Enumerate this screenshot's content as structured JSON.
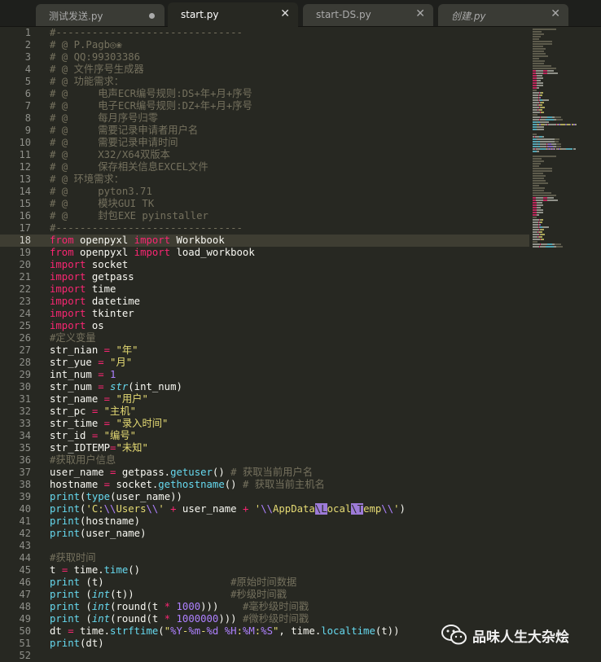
{
  "tabs": [
    {
      "label": "测试发送.py",
      "state": "modified"
    },
    {
      "label": "start.py",
      "state": "active"
    },
    {
      "label": "start-DS.py",
      "state": "normal"
    },
    {
      "label": "创建.py",
      "state": "normal"
    }
  ],
  "current_line": 18,
  "watermark": {
    "text": "品味人生大杂烩",
    "icon": "wechat-icon"
  },
  "lines": [
    [
      [
        "c",
        "#-------------------------------"
      ]
    ],
    [
      [
        "c",
        "# @ P.Pagb◎❀"
      ]
    ],
    [
      [
        "c",
        "# @ QQ:99303386"
      ]
    ],
    [
      [
        "c",
        "# @ 文件序号生成器"
      ]
    ],
    [
      [
        "c",
        "# @ 功能需求："
      ]
    ],
    [
      [
        "c",
        "# @     电声ECR编号规则:DS+年+月+序号"
      ]
    ],
    [
      [
        "c",
        "# @     电子ECR编号规则:DZ+年+月+序号"
      ]
    ],
    [
      [
        "c",
        "# @     每月序号归零"
      ]
    ],
    [
      [
        "c",
        "# @     需要记录申请者用户名"
      ]
    ],
    [
      [
        "c",
        "# @     需要记录申请时间"
      ]
    ],
    [
      [
        "c",
        "# @     X32/X64双版本"
      ]
    ],
    [
      [
        "c",
        "# @     保存相关信息EXCEL文件"
      ]
    ],
    [
      [
        "c",
        "# @ 环境需求："
      ]
    ],
    [
      [
        "c",
        "# @     pyton3.71"
      ]
    ],
    [
      [
        "c",
        "# @     模块GUI TK"
      ]
    ],
    [
      [
        "c",
        "# @     封包EXE pyinstaller"
      ]
    ],
    [
      [
        "c",
        "#-------------------------------"
      ]
    ],
    [
      [
        "k",
        "from"
      ],
      [
        "t",
        " openpyxl "
      ],
      [
        "k",
        "import"
      ],
      [
        "t",
        " Workbook"
      ]
    ],
    [
      [
        "k",
        "from"
      ],
      [
        "t",
        " openpyxl "
      ],
      [
        "k",
        "import"
      ],
      [
        "t",
        " load_workbook"
      ]
    ],
    [
      [
        "k",
        "import"
      ],
      [
        "t",
        " socket"
      ]
    ],
    [
      [
        "k",
        "import"
      ],
      [
        "t",
        " getpass"
      ]
    ],
    [
      [
        "k",
        "import"
      ],
      [
        "t",
        " time"
      ]
    ],
    [
      [
        "k",
        "import"
      ],
      [
        "t",
        " datetime"
      ]
    ],
    [
      [
        "k",
        "import"
      ],
      [
        "t",
        " tkinter"
      ]
    ],
    [
      [
        "k",
        "import"
      ],
      [
        "t",
        " os"
      ]
    ],
    [
      [
        "c",
        "#定义变量"
      ]
    ],
    [
      [
        "t",
        "str_nian "
      ],
      [
        "k",
        "="
      ],
      [
        "t",
        " "
      ],
      [
        "s",
        "\"年\""
      ]
    ],
    [
      [
        "t",
        "str_yue "
      ],
      [
        "k",
        "="
      ],
      [
        "t",
        " "
      ],
      [
        "s",
        "\"月\""
      ]
    ],
    [
      [
        "t",
        "int_num "
      ],
      [
        "k",
        "="
      ],
      [
        "t",
        " "
      ],
      [
        "n",
        "1"
      ]
    ],
    [
      [
        "t",
        "str_num "
      ],
      [
        "k",
        "="
      ],
      [
        "t",
        " "
      ],
      [
        "fi",
        "str"
      ],
      [
        "t",
        "(int_num)"
      ]
    ],
    [
      [
        "t",
        "str_name "
      ],
      [
        "k",
        "="
      ],
      [
        "t",
        " "
      ],
      [
        "s",
        "\"用户\""
      ]
    ],
    [
      [
        "t",
        "str_pc "
      ],
      [
        "k",
        "="
      ],
      [
        "t",
        " "
      ],
      [
        "s",
        "\"主机\""
      ]
    ],
    [
      [
        "t",
        "str_time "
      ],
      [
        "k",
        "="
      ],
      [
        "t",
        " "
      ],
      [
        "s",
        "\"录入时间\""
      ]
    ],
    [
      [
        "t",
        "str_id "
      ],
      [
        "k",
        "="
      ],
      [
        "t",
        " "
      ],
      [
        "s",
        "\"编号\""
      ]
    ],
    [
      [
        "t",
        "str_IDTEMP"
      ],
      [
        "k",
        "="
      ],
      [
        "s",
        "\"未知\""
      ]
    ],
    [
      [
        "c",
        "#获取用户信息"
      ]
    ],
    [
      [
        "t",
        "user_name "
      ],
      [
        "k",
        "="
      ],
      [
        "t",
        " getpass."
      ],
      [
        "f",
        "getuser"
      ],
      [
        "t",
        "() "
      ],
      [
        "c",
        "# 获取当前用户名"
      ]
    ],
    [
      [
        "t",
        "hostname "
      ],
      [
        "k",
        "="
      ],
      [
        "t",
        " socket."
      ],
      [
        "f",
        "gethostname"
      ],
      [
        "t",
        "() "
      ],
      [
        "c",
        "# 获取当前主机名"
      ]
    ],
    [
      [
        "f",
        "print"
      ],
      [
        "t",
        "("
      ],
      [
        "f",
        "type"
      ],
      [
        "t",
        "(user_name))"
      ]
    ],
    [
      [
        "f",
        "print"
      ],
      [
        "t",
        "("
      ],
      [
        "s",
        "'C:"
      ],
      [
        "n",
        "\\\\"
      ],
      [
        "s",
        "Users"
      ],
      [
        "n",
        "\\\\"
      ],
      [
        "s",
        "'"
      ],
      [
        "t",
        " "
      ],
      [
        "k",
        "+"
      ],
      [
        "t",
        " user_name "
      ],
      [
        "k",
        "+"
      ],
      [
        "t",
        " "
      ],
      [
        "s",
        "'"
      ],
      [
        "n",
        "\\\\"
      ],
      [
        "s",
        "AppData"
      ],
      [
        "hl",
        "\\L"
      ],
      [
        "s",
        "ocal"
      ],
      [
        "hl",
        "\\T"
      ],
      [
        "s",
        "emp"
      ],
      [
        "n",
        "\\\\"
      ],
      [
        "s",
        "'"
      ],
      [
        "t",
        ")"
      ]
    ],
    [
      [
        "f",
        "print"
      ],
      [
        "t",
        "(hostname)"
      ]
    ],
    [
      [
        "f",
        "print"
      ],
      [
        "t",
        "(user_name)"
      ]
    ],
    [],
    [
      [
        "c",
        "#获取时间"
      ]
    ],
    [
      [
        "t",
        "t "
      ],
      [
        "k",
        "="
      ],
      [
        "t",
        " time."
      ],
      [
        "f",
        "time"
      ],
      [
        "t",
        "()"
      ]
    ],
    [
      [
        "f",
        "print"
      ],
      [
        "t",
        " (t)                     "
      ],
      [
        "c",
        "#原始时间数据"
      ]
    ],
    [
      [
        "f",
        "print"
      ],
      [
        "t",
        " ("
      ],
      [
        "fi",
        "int"
      ],
      [
        "t",
        "(t))                "
      ],
      [
        "c",
        "#秒级时间戳"
      ]
    ],
    [
      [
        "f",
        "print"
      ],
      [
        "t",
        " ("
      ],
      [
        "fi",
        "int"
      ],
      [
        "t",
        "(round(t "
      ],
      [
        "k",
        "*"
      ],
      [
        "t",
        " "
      ],
      [
        "n",
        "1000"
      ],
      [
        "t",
        ")))    "
      ],
      [
        "c",
        "#毫秒级时间戳"
      ]
    ],
    [
      [
        "f",
        "print"
      ],
      [
        "t",
        " ("
      ],
      [
        "fi",
        "int"
      ],
      [
        "t",
        "(round(t "
      ],
      [
        "k",
        "*"
      ],
      [
        "t",
        " "
      ],
      [
        "n",
        "1000000"
      ],
      [
        "t",
        "))) "
      ],
      [
        "c",
        "#微秒级时间戳"
      ]
    ],
    [
      [
        "t",
        "dt "
      ],
      [
        "k",
        "="
      ],
      [
        "t",
        " time."
      ],
      [
        "f",
        "strftime"
      ],
      [
        "t",
        "("
      ],
      [
        "s",
        "\""
      ],
      [
        "n",
        "%Y"
      ],
      [
        "s",
        "-"
      ],
      [
        "n",
        "%m"
      ],
      [
        "s",
        "-"
      ],
      [
        "n",
        "%d"
      ],
      [
        "s",
        " "
      ],
      [
        "n",
        "%H"
      ],
      [
        "s",
        ":"
      ],
      [
        "n",
        "%M"
      ],
      [
        "s",
        ":"
      ],
      [
        "n",
        "%S"
      ],
      [
        "s",
        "\""
      ],
      [
        "t",
        ", time."
      ],
      [
        "f",
        "localtime"
      ],
      [
        "t",
        "(t))"
      ]
    ],
    [
      [
        "f",
        "print"
      ],
      [
        "t",
        "(dt)"
      ]
    ],
    []
  ]
}
